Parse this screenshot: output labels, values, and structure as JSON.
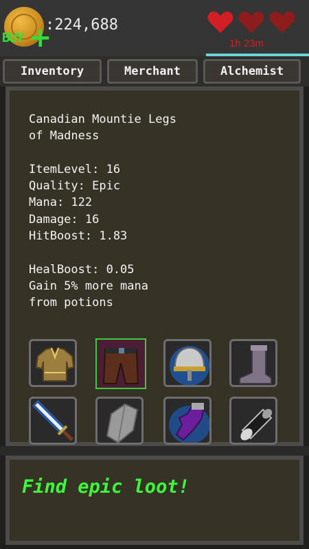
{
  "currency": {
    "gold": ":224,688",
    "buy_label": "BUY",
    "plus": "+",
    "coin_icon": "gold-coin-icon"
  },
  "lives": {
    "hearts": [
      {
        "icon": "heart-icon",
        "color": "#d21e24"
      },
      {
        "icon": "heart-icon",
        "color": "#8e1c1c"
      },
      {
        "icon": "heart-icon",
        "color": "#8e1c1c"
      }
    ],
    "timer": "1h 23m"
  },
  "tabs": [
    {
      "label": "Inventory"
    },
    {
      "label": "Merchant"
    },
    {
      "label": "Alchemist"
    }
  ],
  "item": {
    "name_line1": "Canadian Mountie Legs",
    "name_line2": "of Madness",
    "item_level": "ItemLevel: 16",
    "quality": "Quality: Epic",
    "mana": "Mana: 122",
    "damage": "Damage: 16",
    "hitboost": "HitBoost: 1.83",
    "healboost": "HealBoost: 0.05",
    "bonus_line1": "Gain 5% more mana",
    "bonus_line2": "from potions"
  },
  "inventory": {
    "slots": [
      {
        "icon": "tunic-icon",
        "selected": false
      },
      {
        "icon": "leather-pants-icon",
        "selected": true
      },
      {
        "icon": "helmet-icon",
        "selected": false
      },
      {
        "icon": "boot-icon",
        "selected": false
      },
      {
        "icon": "sword-icon",
        "selected": false
      },
      {
        "icon": "shield-icon",
        "selected": false
      },
      {
        "icon": "glove-icon",
        "selected": false
      },
      {
        "icon": "bracer-icon",
        "selected": false
      }
    ]
  },
  "message": "Find epic loot!",
  "colors": {
    "message_green": "#3cff3c",
    "buy_green": "#2ee038",
    "timer_red": "#d01e1e",
    "selected_slot_border": "#37d03a"
  }
}
